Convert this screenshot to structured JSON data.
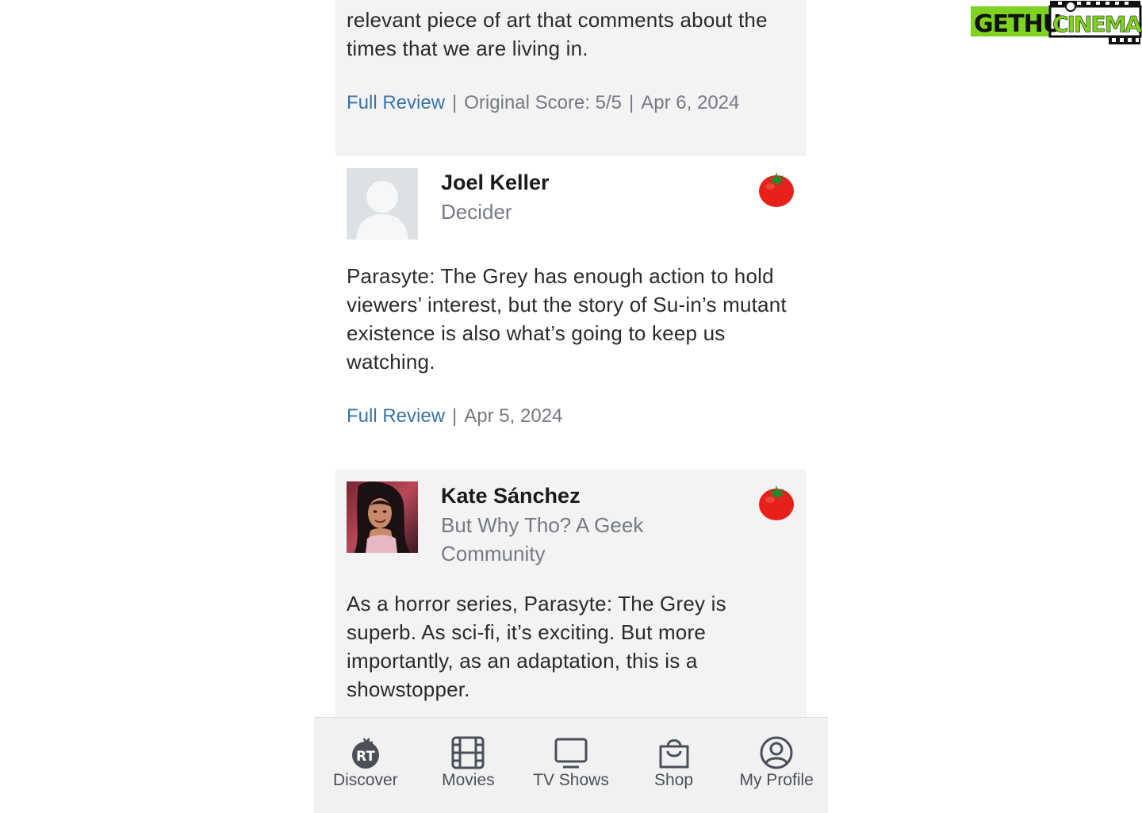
{
  "brand": {
    "logo_text_left": "GETHU",
    "logo_text_right": "CINEMA"
  },
  "reviews": [
    {
      "quote": "relevant piece of art that comments about the times that we are living in.",
      "link_label": "Full Review",
      "score": "Original Score: 5/5",
      "date": "Apr 6, 2024"
    },
    {
      "critic": "Joel Keller",
      "publication": "Decider",
      "quote": "Parasyte: The Grey has enough action to hold viewers’ interest, but the story of Su-in’s mutant existence is also what’s going to keep us watching.",
      "link_label": "Full Review",
      "date": "Apr 5, 2024"
    },
    {
      "critic": "Kate Sánchez",
      "publication": "But Why Tho? A Geek Community",
      "quote": "As a horror series, Parasyte: The Grey is superb. As sci-fi, it’s exciting. But more importantly, as an adaptation, this is a showstopper."
    }
  ],
  "nav": [
    {
      "label": "Discover",
      "icon": "rt-discover-icon"
    },
    {
      "label": "Movies",
      "icon": "film-icon"
    },
    {
      "label": "TV Shows",
      "icon": "tv-icon"
    },
    {
      "label": "Shop",
      "icon": "shopping-bag-icon"
    },
    {
      "label": "My Profile",
      "icon": "profile-icon"
    }
  ],
  "colors": {
    "link": "#3a74a8",
    "meta": "#757a84",
    "card_gray": "#f3f3f3",
    "tomato_red": "#e8201a",
    "logo_green": "#7ed321"
  }
}
